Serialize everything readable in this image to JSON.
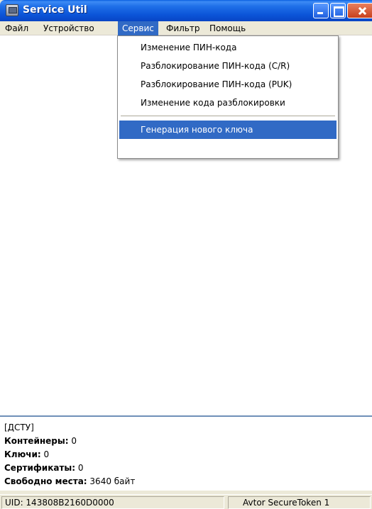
{
  "window": {
    "title": "Service Util"
  },
  "menubar": {
    "items": [
      "Файл",
      "Устройство",
      "Сервис",
      "Фильтр",
      "Помощь"
    ],
    "active_index": 2
  },
  "dropdown": {
    "items": [
      "Изменение ПИН-кода",
      "Разблокирование ПИН-кода (C/R)",
      "Разблокирование ПИН-кода (PUK)",
      "Изменение кода разблокировки"
    ],
    "highlighted_item": "Генерация нового ключа"
  },
  "info": {
    "header": "[ДСТУ]",
    "containers_label": "Контейнеры:",
    "containers_value": "0",
    "keys_label": "Ключи:",
    "keys_value": "0",
    "certs_label": "Сертификаты:",
    "certs_value": "0",
    "free_label": "Свободно места:",
    "free_value": "3640 байт"
  },
  "statusbar": {
    "uid": "UID: 143808B2160D0000",
    "device": "Avtor SecureToken 1"
  },
  "colors": {
    "selection": "#316ac5",
    "titlebar": "#0b54d8"
  }
}
